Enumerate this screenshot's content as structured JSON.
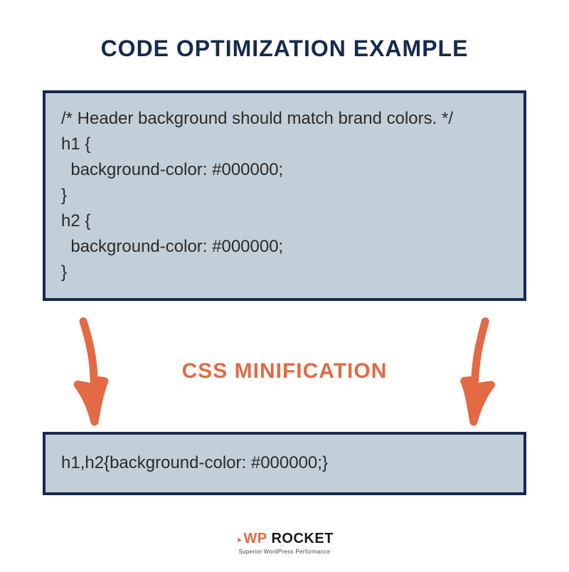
{
  "title": "CODE OPTIMIZATION EXAMPLE",
  "subtitle": "CSS MINIFICATION",
  "code_before": "/* Header background should match brand colors. */\nh1 {\n  background-color: #000000;\n}\nh2 {\n  background-color: #000000;\n}",
  "code_after": "h1,h2{background-color: #000000;}",
  "logo": {
    "wp": "WP",
    "rocket": "ROCKET",
    "tagline": "Superior WordPress Performance"
  },
  "colors": {
    "navy": "#16294f",
    "orange": "#e36a44",
    "box_bg": "#c3cfd8"
  }
}
